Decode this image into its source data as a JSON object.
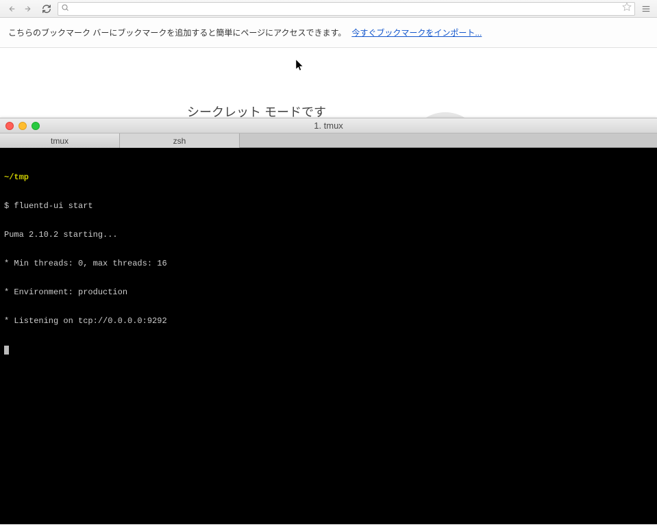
{
  "browser": {
    "back_enabled": false,
    "forward_enabled": false,
    "reload_enabled": true,
    "url": "",
    "url_placeholder": ""
  },
  "bookmark_bar": {
    "message": "こちらのブックマーク バーにブックマークを追加すると簡単にページにアクセスできます。",
    "import_link": "今すぐブックマークをインポート..."
  },
  "incognito": {
    "title": "シークレット モードです"
  },
  "terminal": {
    "window_title": "1. tmux",
    "tabs": [
      {
        "label": "tmux",
        "active": true
      },
      {
        "label": "zsh",
        "active": false
      }
    ],
    "cwd": "~/tmp",
    "prompt": "$",
    "command": "fluentd-ui start",
    "output": [
      "Puma 2.10.2 starting...",
      "* Min threads: 0, max threads: 16",
      "* Environment: production",
      "* Listening on tcp://0.0.0.0:9292"
    ]
  }
}
